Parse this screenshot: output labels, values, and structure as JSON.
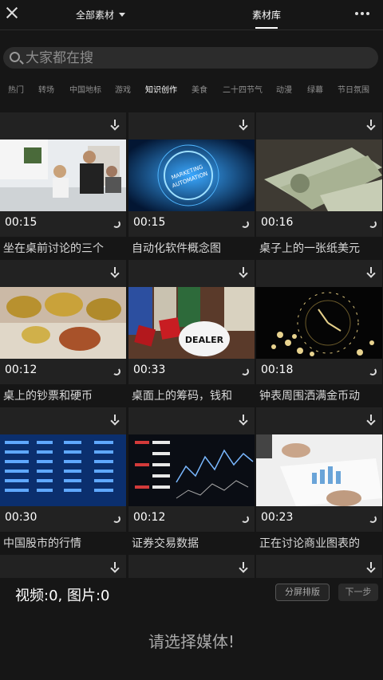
{
  "header": {
    "filter_label": "全部素材",
    "library_title": "素材库"
  },
  "search": {
    "placeholder": "大家都在搜"
  },
  "categories": [
    "热门",
    "转场",
    "中国地标",
    "游戏",
    "知识创作",
    "美食",
    "二十四节气",
    "动漫",
    "绿幕",
    "节日氛围"
  ],
  "active_category": "知识创作",
  "media": [
    {
      "duration": "00:15",
      "title": "坐在桌前讨论的三个"
    },
    {
      "duration": "00:15",
      "title": "自动化软件概念图"
    },
    {
      "duration": "00:16",
      "title": "桌子上的一张纸美元"
    },
    {
      "duration": "00:12",
      "title": "桌上的钞票和硬币"
    },
    {
      "duration": "00:33",
      "title": "桌面上的筹码，钱和"
    },
    {
      "duration": "00:18",
      "title": "钟表周围洒满金币动"
    },
    {
      "duration": "00:30",
      "title": "中国股市的行情"
    },
    {
      "duration": "00:12",
      "title": "证券交易数据"
    },
    {
      "duration": "00:23",
      "title": "正在讨论商业图表的"
    }
  ],
  "thumbnail_text": {
    "marketing": "MARKETING",
    "automation": "AUTOMATION",
    "dealer": "DEALER"
  },
  "footer": {
    "selection_count": "视频:0, 图片:0",
    "split_button": "分屏排版",
    "next_button": "下一步",
    "empty_hint": "请选择媒体!"
  },
  "icons": {
    "close": "close-icon",
    "dropdown": "caret-down-icon",
    "more": "more-dots-icon",
    "search": "search-icon",
    "download": "download-icon",
    "expand": "expand-icon"
  }
}
